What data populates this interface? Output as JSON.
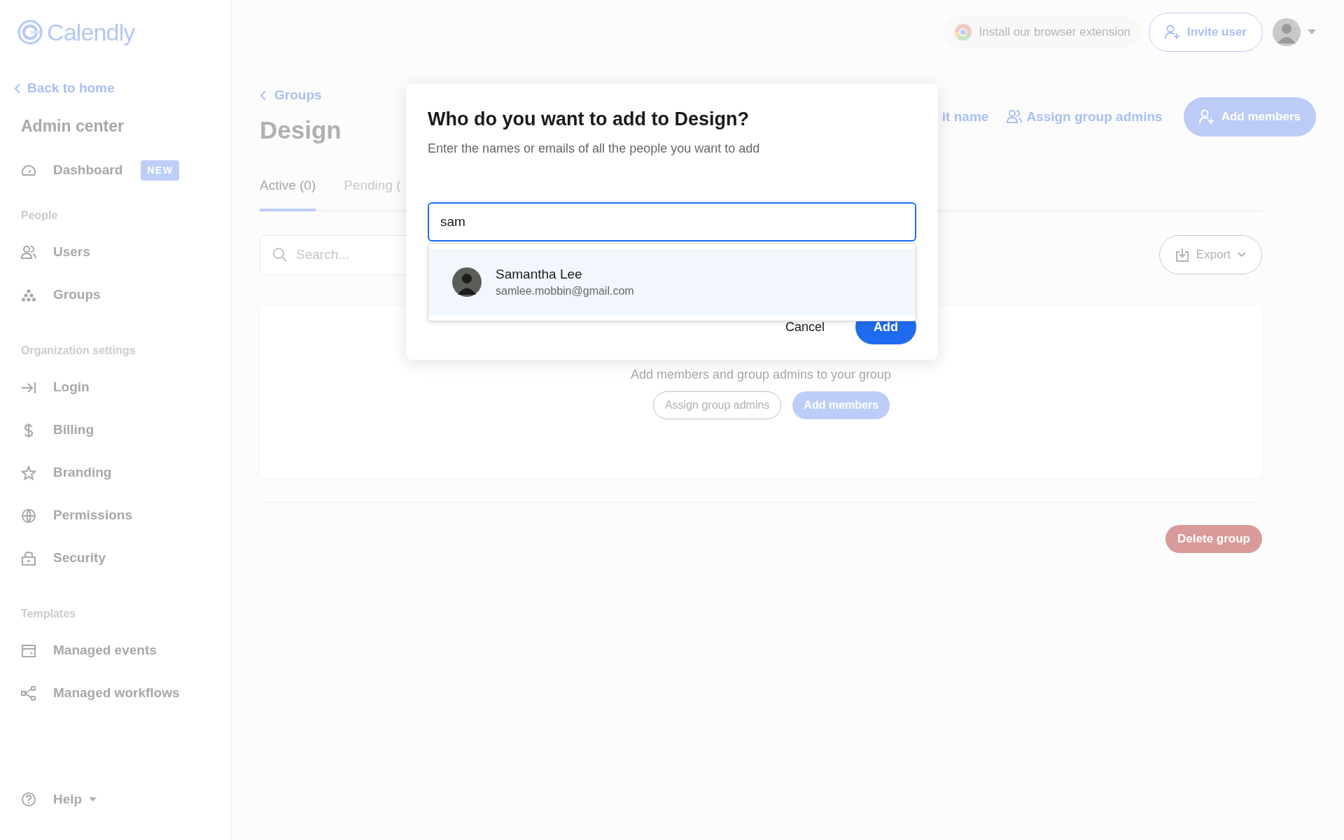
{
  "logo": {
    "text": "Calendly"
  },
  "sidebar": {
    "back_link": "Back to home",
    "title": "Admin center",
    "sections": [
      {
        "items": [
          {
            "label": "Dashboard",
            "badge": "NEW"
          }
        ]
      },
      {
        "heading": "People",
        "items": [
          {
            "label": "Users"
          },
          {
            "label": "Groups"
          }
        ]
      },
      {
        "heading": "Organization settings",
        "items": [
          {
            "label": "Login"
          },
          {
            "label": "Billing"
          },
          {
            "label": "Branding"
          },
          {
            "label": "Permissions"
          },
          {
            "label": "Security"
          }
        ]
      },
      {
        "heading": "Templates",
        "items": [
          {
            "label": "Managed events"
          },
          {
            "label": "Managed workflows"
          }
        ]
      }
    ],
    "help": "Help"
  },
  "header": {
    "extension": "Install our browser extension",
    "invite_button": "Invite user"
  },
  "breadcrumb": "Groups",
  "group_title": "Design",
  "actions": {
    "edit_name": "it name",
    "assign": "Assign group admins",
    "add": "Add members"
  },
  "tabs": [
    {
      "label": "Active (0)",
      "selected": true
    },
    {
      "label": "Pending (",
      "selected": false
    }
  ],
  "search": {
    "placeholder": "Search..."
  },
  "export": "Export",
  "empty_state": {
    "text": "Add members and group admins to your group",
    "buttons": [
      "Assign group admins",
      "Add members"
    ]
  },
  "delete_button": "Delete group",
  "dialog": {
    "title": "Who do you want to add to Design?",
    "subtitle": "Enter the names or emails of all the people you want to add",
    "input": {
      "value": "sam"
    },
    "suggestions": [
      {
        "name": "Samantha Lee",
        "email": "samlee.mobbin@gmail.com",
        "selected": true
      }
    ],
    "buttons": [
      "Cancel",
      "Add"
    ]
  }
}
